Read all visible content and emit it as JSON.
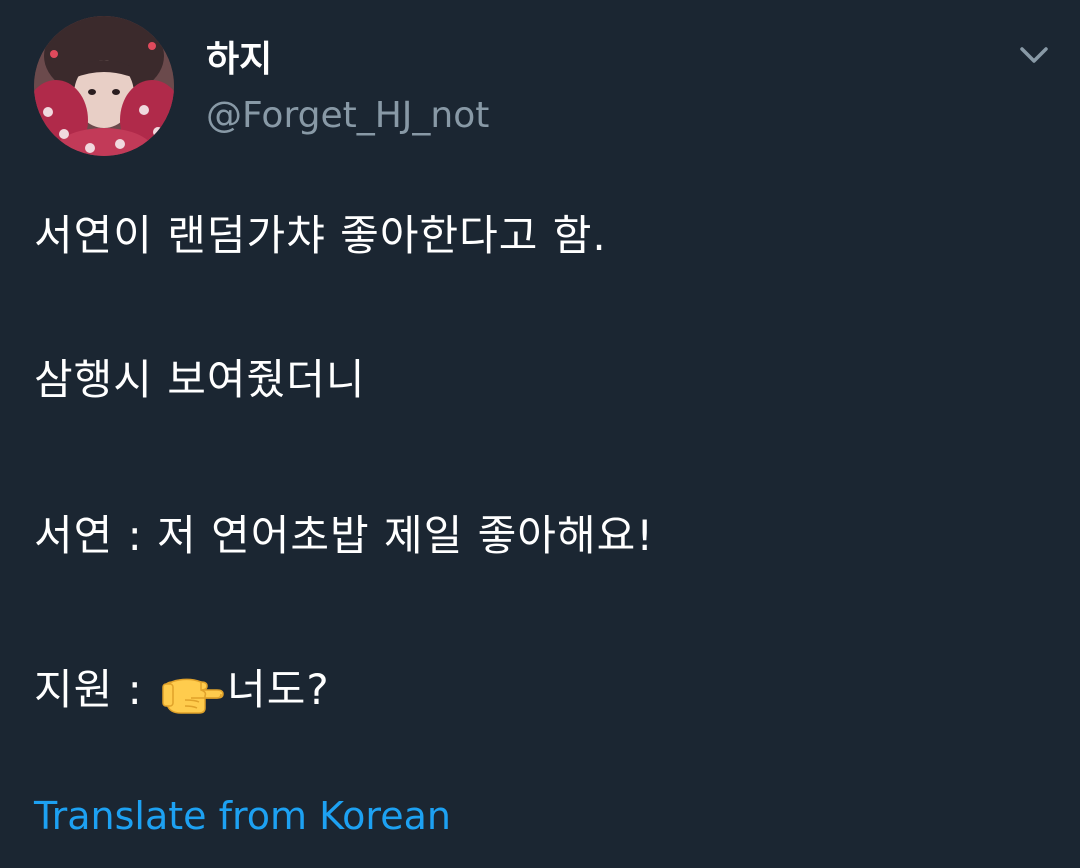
{
  "tweet": {
    "author": {
      "display_name": "하지",
      "handle": "@Forget_HJ_not",
      "avatar_icon": "profile-photo"
    },
    "menu_icon": "chevron-down-icon",
    "lines": [
      "서연이 랜덤가챠 좋아한다고 함.",
      "삼행시 보여줬더니",
      "서연 : 저 연어초밥 제일 좋아해요!"
    ],
    "last_line": {
      "prefix": "지원 : ",
      "emoji_icon": "backhand-index-pointing-right-icon",
      "suffix": "너도?"
    },
    "translate_label": "Translate from Korean"
  },
  "colors": {
    "background": "#1b2632",
    "text": "#ffffff",
    "secondary_text": "#8899a6",
    "link": "#1da1f2"
  }
}
